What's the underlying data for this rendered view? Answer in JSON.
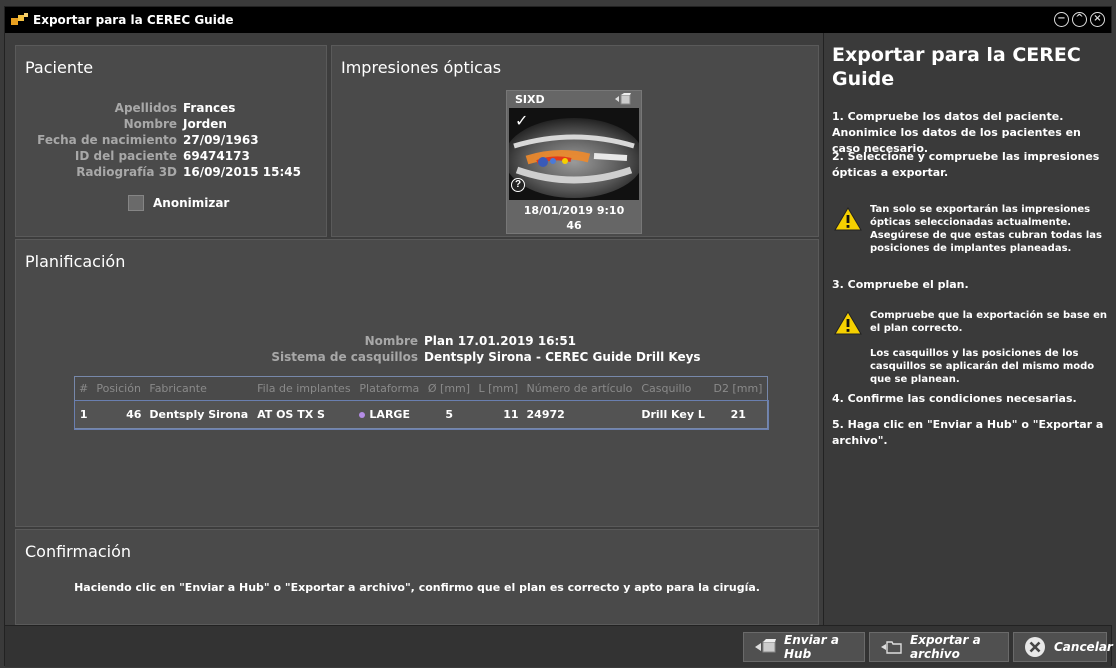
{
  "window": {
    "title": "Exportar para la CEREC Guide",
    "controls": [
      "minimize",
      "restore",
      "close"
    ]
  },
  "patient": {
    "heading": "Paciente",
    "fields": [
      {
        "label": "Apellidos",
        "value": "Frances"
      },
      {
        "label": "Nombre",
        "value": "Jorden"
      },
      {
        "label": "Fecha de nacimiento",
        "value": "27/09/1963"
      },
      {
        "label": "ID del paciente",
        "value": "69474173"
      },
      {
        "label": "Radiografía 3D",
        "value": "16/09/2015 15:45"
      }
    ],
    "anonymize_label": "Anonimizar",
    "anonymize_checked": false
  },
  "impressions": {
    "heading": "Impresiones ópticas",
    "scan": {
      "label": "SIXD",
      "selected": true,
      "date": "18/01/2019 9:10",
      "tooth": "46"
    }
  },
  "planning": {
    "heading": "Planificación",
    "fields": [
      {
        "label": "Nombre",
        "value": "Plan 17.01.2019 16:51"
      },
      {
        "label": "Sistema de casquillos",
        "value": "Dentsply Sirona - CEREC Guide Drill Keys"
      }
    ],
    "table": {
      "columns": [
        "#",
        "Posición",
        "Fabricante",
        "Fila de implantes",
        "Plataforma",
        "Ø [mm]",
        "L [mm]",
        "Número de artículo",
        "Casquillo",
        "D2 [mm]"
      ],
      "rows": [
        {
          "n": "1",
          "position": "46",
          "manufacturer": "Dentsply Sirona",
          "line": "AT OS TX S",
          "platform": "LARGE",
          "platform_color": "#b48ce6",
          "diameter": "5",
          "length": "11",
          "article": "24972",
          "sleeve": "Drill Key L",
          "d2": "21"
        }
      ]
    }
  },
  "confirmation": {
    "heading": "Confirmación",
    "text": "Haciendo clic en \"Enviar a Hub\" o \"Exportar a archivo\", confirmo que el plan es correcto y apto para la cirugía."
  },
  "help": {
    "title": "Exportar para la CEREC Guide",
    "step1": "1. Compruebe los datos del paciente. Anonimice los datos de los pacientes en caso necesario.",
    "step2": "2. Seleccione y compruebe las impresiones ópticas a exportar.",
    "warn1": "Tan solo se exportarán las impresiones ópticas seleccionadas actualmente. Asegúrese de que estas cubran todas las posiciones de implantes planeadas.",
    "step3": "3. Compruebe el plan.",
    "warn2": "Compruebe que la exportación se base en el plan correcto.",
    "note2": "Los casquillos y las posiciones de los casquillos se aplicarán del mismo modo que se planean.",
    "step4": "4. Confirme las condiciones necesarias.",
    "step5": "5. Haga clic en \"Enviar a Hub\" o \"Exportar a archivo\"."
  },
  "footer": {
    "send_hub": "Enviar a Hub",
    "export_file": "Exportar a archivo",
    "cancel": "Cancelar"
  },
  "colors": {
    "accent_warning": "#f5d000",
    "table_border": "#7788aa",
    "platform_large": "#b48ce6"
  }
}
